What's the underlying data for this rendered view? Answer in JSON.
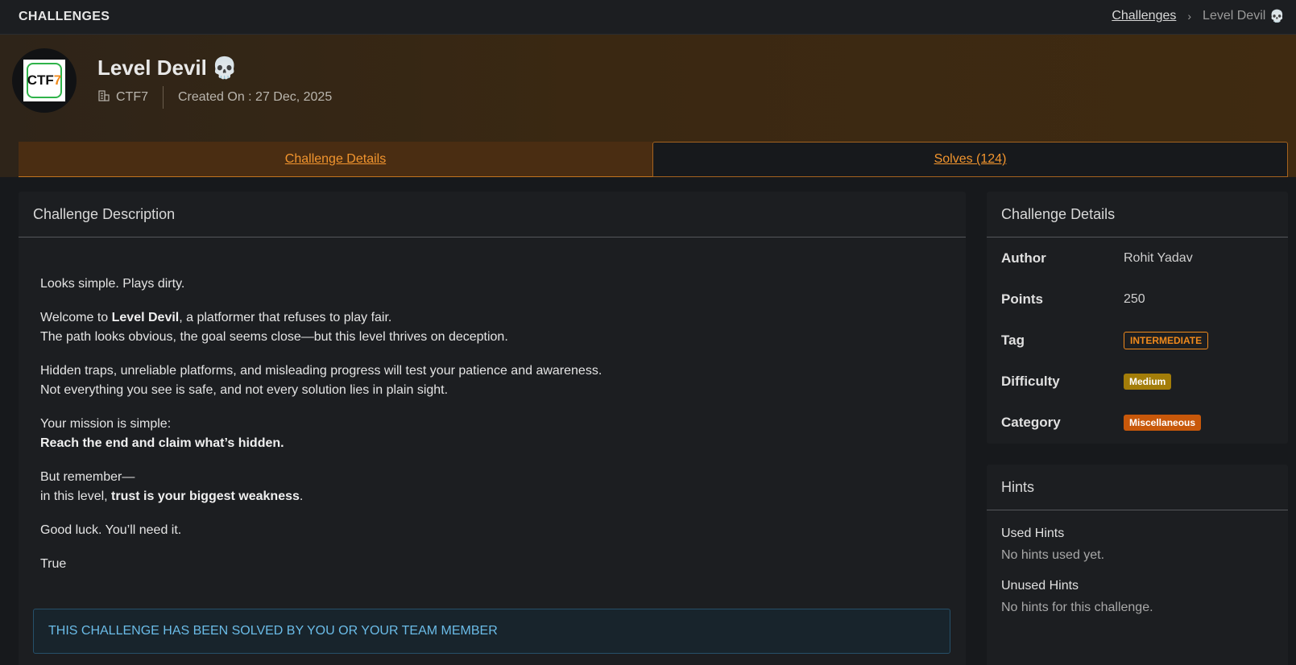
{
  "topbar": {
    "brand": "CHALLENGES",
    "breadcrumb": {
      "link": "Challenges",
      "separator": "›",
      "current": "Level Devil",
      "current_emoji": "💀"
    }
  },
  "header": {
    "logo_text_a": "CTF",
    "logo_text_b": "7",
    "title": "Level Devil",
    "title_emoji": "💀",
    "org": "CTF7",
    "created": "Created On : 27 Dec, 2025"
  },
  "tabs": [
    {
      "label": "Challenge Details"
    },
    {
      "label": "Solves (124)"
    }
  ],
  "description": {
    "heading": "Challenge Description",
    "p1": "Looks simple. Plays dirty.",
    "p2_pre": "Welcome to ",
    "p2_bold": "Level Devil",
    "p2_post": ", a platformer that refuses to play fair.",
    "p2_line2": "The path looks obvious, the goal seems close—but this level thrives on deception.",
    "p3_line1": "Hidden traps, unreliable platforms, and misleading progress will test your patience and awareness.",
    "p3_line2": "Not everything you see is safe, and not every solution lies in plain sight.",
    "p4_line1": "Your mission is simple:",
    "p4_bold": "Reach the end and claim what’s hidden.",
    "p5_line1": "But remember—",
    "p5_pre": "in this level, ",
    "p5_bold": "trust is your biggest weakness",
    "p5_post": ".",
    "p6": "Good luck. You’ll need it.",
    "p7": "True",
    "solved_notice": "THIS CHALLENGE HAS BEEN SOLVED BY YOU OR YOUR TEAM MEMBER"
  },
  "details": {
    "heading": "Challenge Details",
    "rows": [
      {
        "key": "Author",
        "value": "Rohit Yadav"
      },
      {
        "key": "Points",
        "value": "250"
      },
      {
        "key": "Tag",
        "value": "INTERMEDIATE"
      },
      {
        "key": "Difficulty",
        "value": "Medium"
      },
      {
        "key": "Category",
        "value": "Miscellaneous"
      }
    ]
  },
  "hints": {
    "heading": "Hints",
    "used_label": "Used Hints",
    "used_text": "No hints used yet.",
    "unused_label": "Unused Hints",
    "unused_text": "No hints for this challenge."
  },
  "colors": {
    "accent": "#f2952e",
    "tag_border": "#f08a1c",
    "difficulty_bg": "#a37d09",
    "category_bg": "#c8580a",
    "notice_text": "#6bbce8"
  },
  "icons": {
    "org": "building-icon",
    "skull": "skull-icon",
    "chevron": "chevron-right-icon"
  }
}
